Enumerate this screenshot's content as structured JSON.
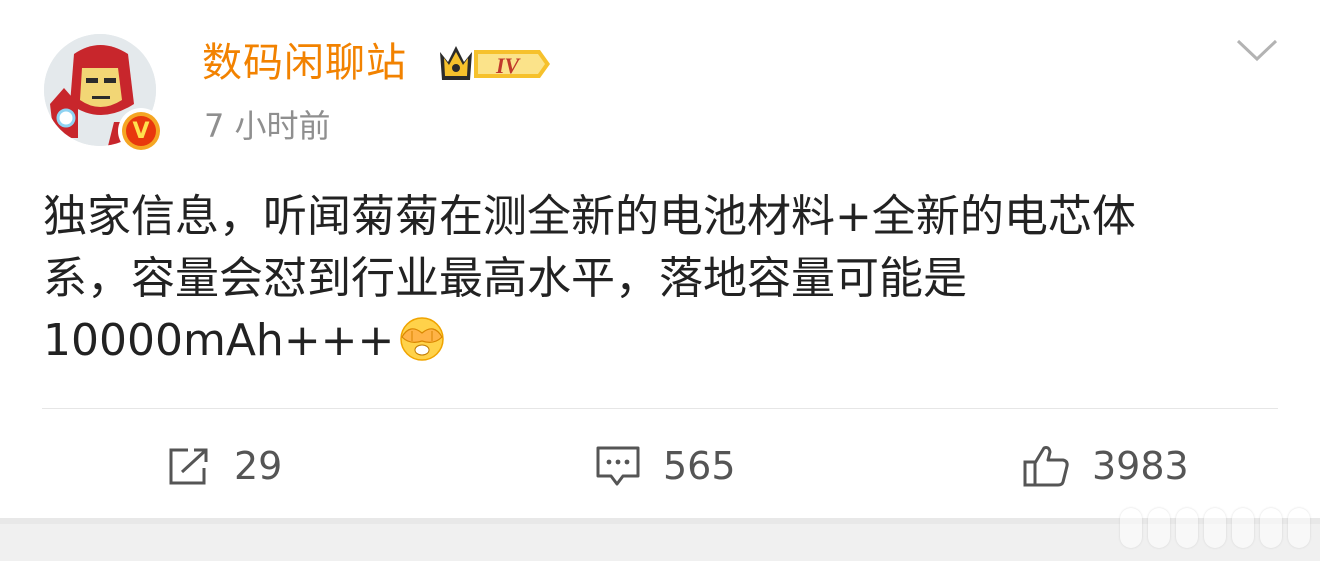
{
  "post": {
    "author": "数码闲聊站",
    "level_badge": "IV",
    "timestamp": "7 小时前",
    "text_lines": [
      "独家信息，听闻菊菊在测全新的电池材料+全新的电芯体",
      "系，容量会怼到行业最高水平，落地容量可能是",
      "10000mAh+++"
    ],
    "emoji": "cover-face-emoji",
    "verified_badge": "V"
  },
  "actions": {
    "repost_count": "29",
    "comment_count": "565",
    "like_count": "3983"
  },
  "colors": {
    "author": "#f28200",
    "text": "#222222",
    "meta": "#8f8f8f",
    "icon": "#555555"
  },
  "icons": {
    "menu": "chevron-down-icon",
    "repost": "share-icon",
    "comment": "comment-icon",
    "like": "thumbs-up-icon"
  }
}
